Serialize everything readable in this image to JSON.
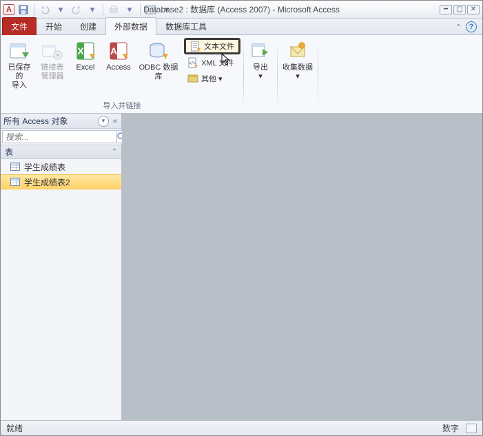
{
  "app_icon_letter": "A",
  "title": "Database2 : 数据库 (Access 2007) - Microsoft Access",
  "tabs": {
    "file": "文件",
    "home": "开始",
    "create": "创建",
    "external": "外部数据",
    "dbtools": "数据库工具"
  },
  "ribbon": {
    "saved_imports": "已保存的\n导入",
    "link_manager": "链接表\n管理器",
    "excel": "Excel",
    "access": "Access",
    "odbc": "ODBC 数据库",
    "text_file": "文本文件",
    "xml_file": "XML 文件",
    "more": "其他 ▾",
    "group1_label": "导入并链接",
    "export": "导出",
    "collect": "收集数据"
  },
  "nav": {
    "header": "所有 Access 对象",
    "search_placeholder": "搜索...",
    "category": "表",
    "items": [
      "学生成绩表",
      "学生成绩表2"
    ],
    "selected_index": 1
  },
  "status": {
    "left": "就绪",
    "right": "数字"
  }
}
